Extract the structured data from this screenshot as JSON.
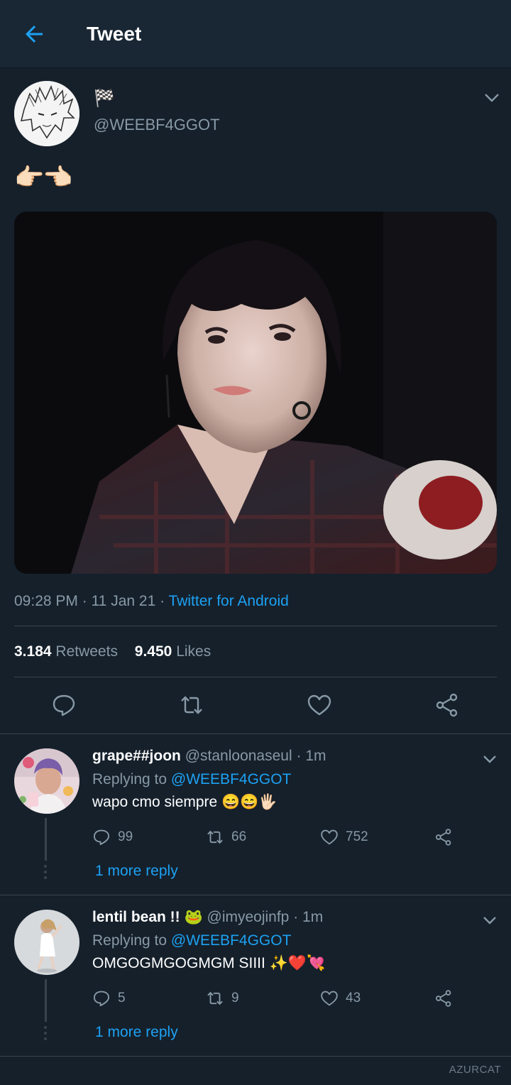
{
  "header": {
    "title": "Tweet",
    "back_icon": "arrow-left-icon"
  },
  "tweet": {
    "display_name": "🏁",
    "handle": "@WEEBF4GGOT",
    "text": "👉🏻👈🏻",
    "time": "09:28 PM",
    "date": "11 Jan 21",
    "client": "Twitter for Android",
    "retweets": "3.184",
    "retweets_label": "Retweets",
    "likes": "9.450",
    "likes_label": "Likes",
    "actions": [
      "reply-icon",
      "retweet-icon",
      "like-icon",
      "share-icon"
    ]
  },
  "replies": [
    {
      "name": "grape##joon",
      "handle": "@stanloonaseul",
      "time": "1m",
      "replying_prefix": "Replying to",
      "replying_to": "@WEEBF4GGOT",
      "text": "wapo cmo siempre 😄😄🖐🏻",
      "reply_count": "99",
      "retweet_count": "66",
      "like_count": "752",
      "more": "1 more reply"
    },
    {
      "name": "lentil bean !! 🐸",
      "handle": "@imyeojinfp",
      "time": "1m",
      "replying_prefix": "Replying to",
      "replying_to": "@WEEBF4GGOT",
      "text": "OMGOGMGOGMGM SIIII ✨❤️💘",
      "reply_count": "5",
      "retweet_count": "9",
      "like_count": "43",
      "more": "1 more reply"
    }
  ],
  "watermark": "AZURCAT",
  "colors": {
    "background": "#15202b",
    "header": "#192734",
    "accent": "#1da1f2",
    "muted": "#8899a6",
    "divider": "#38444d"
  }
}
